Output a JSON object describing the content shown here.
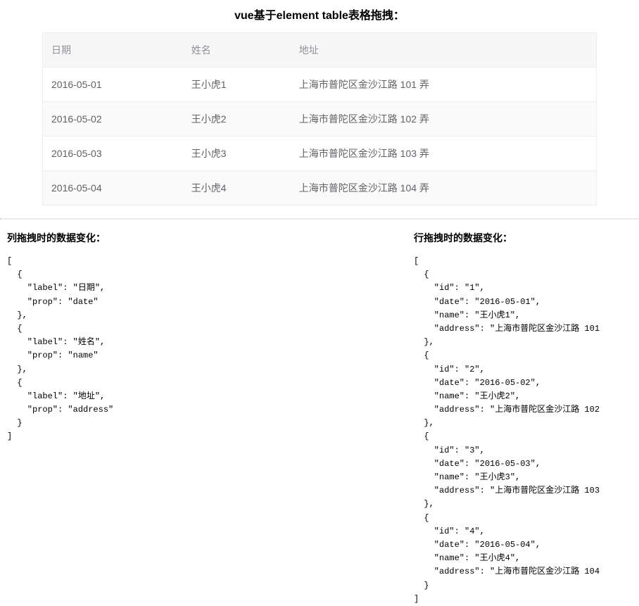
{
  "title": "vue基于element table表格拖拽：",
  "table": {
    "columns": [
      {
        "label": "日期",
        "prop": "date"
      },
      {
        "label": "姓名",
        "prop": "name"
      },
      {
        "label": "地址",
        "prop": "address"
      }
    ],
    "rows": [
      {
        "id": "1",
        "date": "2016-05-01",
        "name": "王小虎1",
        "address": "上海市普陀区金沙江路 101 弄"
      },
      {
        "id": "2",
        "date": "2016-05-02",
        "name": "王小虎2",
        "address": "上海市普陀区金沙江路 102 弄"
      },
      {
        "id": "3",
        "date": "2016-05-03",
        "name": "王小虎3",
        "address": "上海市普陀区金沙江路 103 弄"
      },
      {
        "id": "4",
        "date": "2016-05-04",
        "name": "王小虎4",
        "address": "上海市普陀区金沙江路 104 弄"
      }
    ]
  },
  "panels": {
    "column_title": "列拖拽时的数据变化：",
    "row_title": "行拖拽时的数据变化：",
    "column_json": "[\n  {\n    \"label\": \"日期\",\n    \"prop\": \"date\"\n  },\n  {\n    \"label\": \"姓名\",\n    \"prop\": \"name\"\n  },\n  {\n    \"label\": \"地址\",\n    \"prop\": \"address\"\n  }\n]",
    "row_json": "[\n  {\n    \"id\": \"1\",\n    \"date\": \"2016-05-01\",\n    \"name\": \"王小虎1\",\n    \"address\": \"上海市普陀区金沙江路 101\n  },\n  {\n    \"id\": \"2\",\n    \"date\": \"2016-05-02\",\n    \"name\": \"王小虎2\",\n    \"address\": \"上海市普陀区金沙江路 102\n  },\n  {\n    \"id\": \"3\",\n    \"date\": \"2016-05-03\",\n    \"name\": \"王小虎3\",\n    \"address\": \"上海市普陀区金沙江路 103\n  },\n  {\n    \"id\": \"4\",\n    \"date\": \"2016-05-04\",\n    \"name\": \"王小虎4\",\n    \"address\": \"上海市普陀区金沙江路 104\n  }\n]"
  }
}
